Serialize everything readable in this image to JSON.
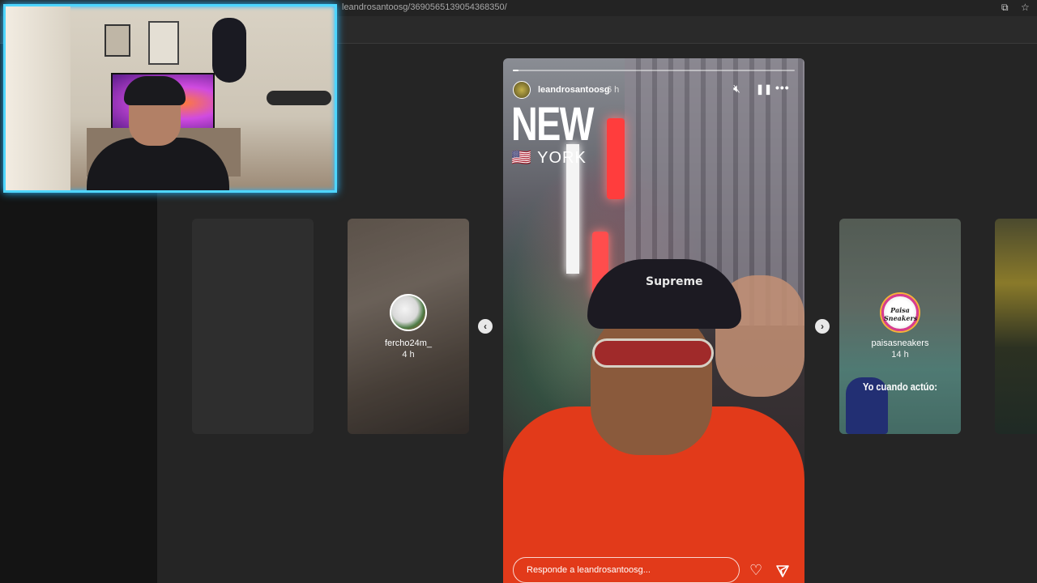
{
  "browser": {
    "url": "leandrosantoosg/3690565139054368350/"
  },
  "stories": {
    "prev_stories": [
      {
        "username": "fercho24m_",
        "time": "4 h"
      }
    ],
    "next_stories": [
      {
        "username": "paisasneakers",
        "time": "14 h",
        "caption": "Yo cuando actúo:",
        "avatar_text": "Paisa Sneakers"
      }
    ],
    "current": {
      "username": "leandrosantoosg",
      "time": "6 h",
      "progress": 0.02,
      "overlay_title": "NEW",
      "overlay_subtitle": "🇺🇸 YORK",
      "cap_text": "Supreme",
      "reply_placeholder": "Responde a leandrosantoosg..."
    }
  },
  "icons": {
    "mute": "mute-icon",
    "pause": "pause-icon",
    "more": "more-icon",
    "heart": "heart-icon",
    "send": "send-icon",
    "prev": "chevron-left-icon",
    "next": "chevron-right-icon"
  }
}
